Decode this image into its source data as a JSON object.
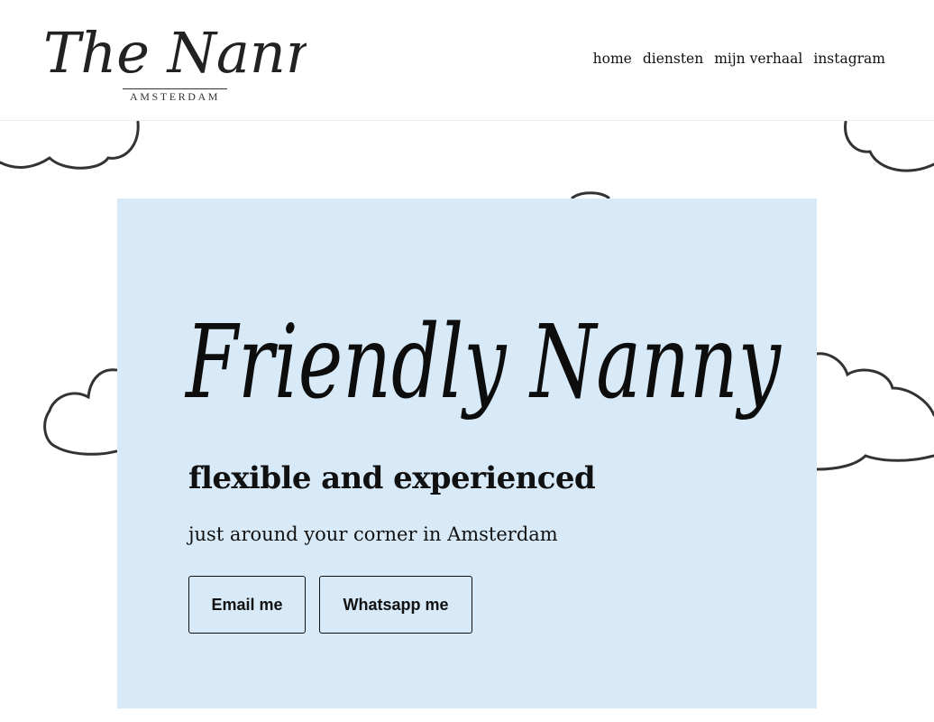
{
  "brand": {
    "logo_script": "The Nanny",
    "logo_subtitle": "AMSTERDAM"
  },
  "nav": {
    "items": [
      "home",
      "diensten",
      "mijn verhaal",
      "instagram"
    ]
  },
  "hero": {
    "title": "Friendly Nanny",
    "subtitle": "flexible and experienced",
    "tagline": "just around your corner in Amsterdam",
    "buttons": {
      "email": "Email me",
      "whatsapp": "Whatsapp me"
    }
  },
  "colors": {
    "hero_background": "#d8eaf7",
    "text": "#111111",
    "page_background": "#ffffff"
  },
  "decorations": [
    "cloud-drawing",
    "cloud-drawing",
    "cloud-drawing",
    "cloud-drawing",
    "cloud-drawing"
  ]
}
